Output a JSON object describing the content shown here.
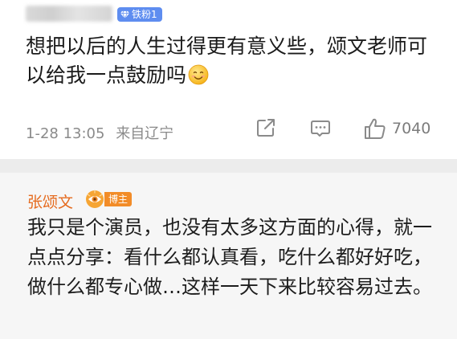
{
  "post": {
    "fan_badge": "铁粉1",
    "text": "想把以后的人生过得更有意义些，颂文老师可以给我一点鼓励吗",
    "time": "1-28 13:05",
    "location": "来自辽宁",
    "like_count": "7040",
    "icons": [
      "share-icon",
      "comment-icon",
      "like-icon",
      "smiley-emoji-icon",
      "diamond-icon"
    ]
  },
  "reply": {
    "username": "张颂文",
    "blogger_badge": "博主",
    "text": "我只是个演员，也没有太多这方面的心得，就一点点分享：看什么都认真看，吃什么都好好吃，做什么都专心做…这样一天下来比较容易过去。"
  },
  "colors": {
    "username_orange": "#e56b1f",
    "fan_badge_blue": "#5e8df0",
    "divider_gray": "#ececec",
    "reply_bg": "#f6f6f6"
  }
}
